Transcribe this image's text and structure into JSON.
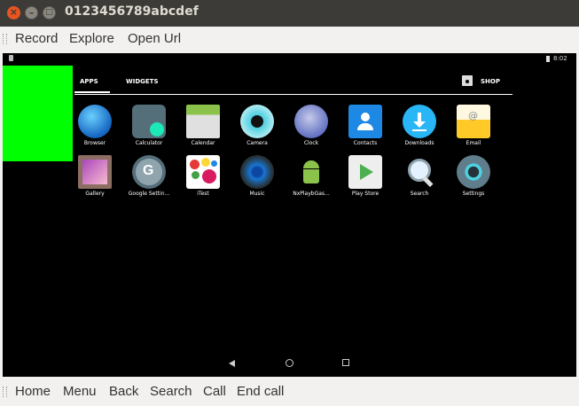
{
  "window": {
    "title": "0123456789abcdef"
  },
  "menu": {
    "items": [
      "Record",
      "Explore",
      "Open Url"
    ]
  },
  "device": {
    "status": {
      "time": "8:02"
    },
    "tabs": {
      "apps": "APPS",
      "widgets": "WIDGETS",
      "shop": "SHOP"
    },
    "apps": [
      {
        "label": "Browser",
        "icon": "globe-icon"
      },
      {
        "label": "Calculator",
        "icon": "calculator-icon"
      },
      {
        "label": "Calendar",
        "icon": "calendar-icon"
      },
      {
        "label": "Camera",
        "icon": "camera-icon"
      },
      {
        "label": "Clock",
        "icon": "clock-icon"
      },
      {
        "label": "Contacts",
        "icon": "contacts-icon"
      },
      {
        "label": "Downloads",
        "icon": "download-icon"
      },
      {
        "label": "Email",
        "icon": "email-icon"
      },
      {
        "label": "Gallery",
        "icon": "gallery-icon"
      },
      {
        "label": "Google Settin...",
        "icon": "google-settings-icon"
      },
      {
        "label": "iTest",
        "icon": "itest-icon"
      },
      {
        "label": "Music",
        "icon": "music-icon"
      },
      {
        "label": "NxPlaybGas...",
        "icon": "android-icon"
      },
      {
        "label": "Play Store",
        "icon": "play-store-icon"
      },
      {
        "label": "Search",
        "icon": "search-icon"
      },
      {
        "label": "Settings",
        "icon": "gear-icon"
      }
    ]
  },
  "bottom": {
    "items": [
      "Home",
      "Menu",
      "Back",
      "Search",
      "Call",
      "End call"
    ]
  }
}
